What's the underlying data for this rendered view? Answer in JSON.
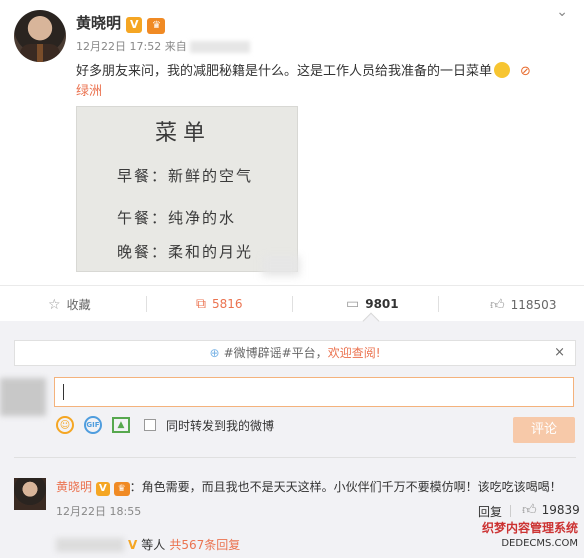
{
  "post": {
    "author": "黄晓明",
    "verified_badge": "V",
    "time": "12月22日 17:52",
    "source_prefix": "来自",
    "text": "好多朋友来问，我的减肥秘籍是什么。这是工作人员给我准备的一日菜单",
    "location": "绿洲",
    "menu": {
      "title": "菜单",
      "breakfast": "早餐：新鲜的空气",
      "lunch": "午餐：纯净的水",
      "dinner": "晚餐：柔和的月光"
    }
  },
  "actions": {
    "favorite": "收藏",
    "repost": "5816",
    "comment": "9801",
    "like": "118503"
  },
  "compose": {
    "notice_prefix": "#微博辟谣#平台，",
    "notice_link": "欢迎查阅!",
    "notice_close": "×",
    "repost_label": "同时转发到我的微博",
    "submit_label": "评论"
  },
  "comment": {
    "author": "黄晓明",
    "text": "：角色需要，而且我也不是天天这样。小伙伴们千万不要模仿啊！该吃吃该喝喝！",
    "time": "12月22日 18:55",
    "reply": "回复",
    "likes": "19839",
    "more_suffix": "等人",
    "more_count": "共567条回复"
  },
  "watermark": {
    "line1": "织梦内容管理系统",
    "line2": "DEDECMS.COM"
  },
  "colors": {
    "accent": "#eb7350",
    "badge": "#f5a623",
    "panel": "#f2f2f5"
  }
}
